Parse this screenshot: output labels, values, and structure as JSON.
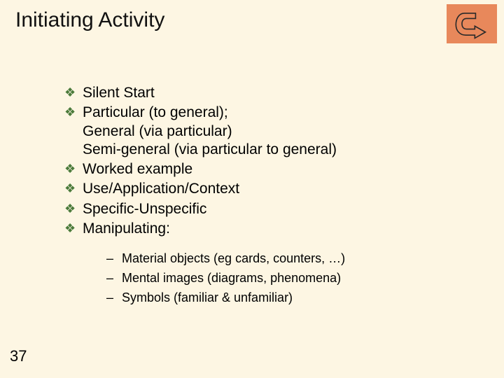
{
  "title": "Initiating Activity",
  "bullets": [
    {
      "text": "Silent Start"
    },
    {
      "text": "Particular (to general);\nGeneral (via particular)\nSemi-general (via particular to general)"
    },
    {
      "text": "Worked example"
    },
    {
      "text": "Use/Application/Context"
    },
    {
      "text": "Specific-Unspecific"
    },
    {
      "text": "Manipulating:"
    }
  ],
  "subitems": [
    "Material objects (eg cards, counters, …)",
    "Mental images (diagrams, phenomena)",
    "Symbols (familiar & unfamiliar)"
  ],
  "page_number": "37",
  "icons": {
    "nav": "u-turn-icon"
  }
}
